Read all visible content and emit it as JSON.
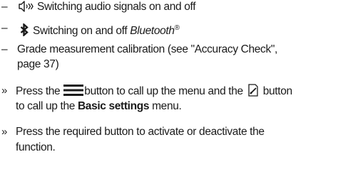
{
  "functions": [
    {
      "bullet": "–",
      "icon": "speaker-sound-icon",
      "text": "Switching audio signals on and off"
    },
    {
      "bullet": "–",
      "icon": "bluetooth-icon",
      "text_prefix": "Switching on and off ",
      "text_italic": "Bluetooth",
      "text_sup": "®"
    },
    {
      "bullet": "–",
      "text_line1": "Grade measurement calibration (see \"Accuracy Check\",",
      "text_line2": "page 37)"
    }
  ],
  "steps": [
    {
      "marker": "»",
      "part1": "Press the",
      "icon1": "menu-icon",
      "part2": "button to call up the menu and the",
      "icon2": "basic-settings-icon",
      "part3": "button",
      "line2_prefix": "to call up the ",
      "line2_bold": "Basic settings",
      "line2_suffix": " menu."
    },
    {
      "marker": "»",
      "line1": "Press the required button to activate or deactivate the",
      "line2": "function."
    }
  ]
}
